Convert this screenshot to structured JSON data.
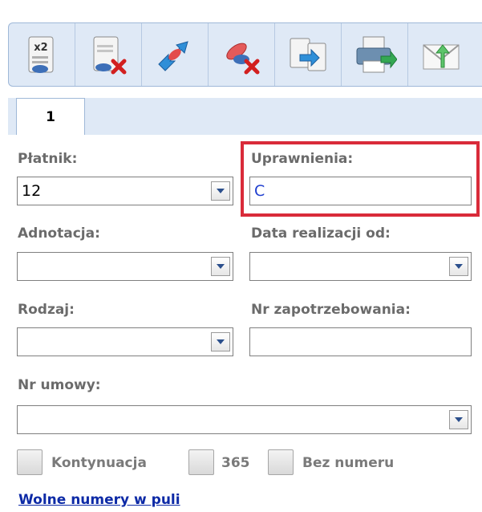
{
  "toolbar": {
    "buttons": [
      {
        "icon": "duplicate-x2-icon",
        "badge": "x2"
      },
      {
        "icon": "delete-document-icon"
      },
      {
        "icon": "swap-arrows-icon"
      },
      {
        "icon": "delete-pills-icon"
      },
      {
        "icon": "transfer-documents-icon"
      },
      {
        "icon": "print-icon"
      },
      {
        "icon": "send-mail-icon"
      }
    ]
  },
  "tabs": [
    {
      "label": "1"
    }
  ],
  "form": {
    "platnik": {
      "label": "Płatnik:",
      "value": "12"
    },
    "uprawnienia": {
      "label": "Uprawnienia:",
      "value": "C"
    },
    "adnotacja": {
      "label": "Adnotacja:",
      "value": ""
    },
    "data_realizacji": {
      "label": "Data realizacji od:",
      "value": ""
    },
    "rodzaj": {
      "label": "Rodzaj:",
      "value": ""
    },
    "nr_zapotrzebowania": {
      "label": "Nr zapotrzebowania:",
      "value": ""
    },
    "nr_umowy": {
      "label": "Nr umowy:",
      "value": ""
    }
  },
  "checkboxes": [
    {
      "label": "Kontynuacja",
      "checked": false
    },
    {
      "label": "365",
      "checked": false
    },
    {
      "label": "Bez numeru",
      "checked": false
    }
  ],
  "link": {
    "label": "Wolne numery w puli"
  },
  "colors": {
    "highlight": "#d92b3a",
    "link": "#0d2aa6",
    "value_blue": "#1f3fcf"
  }
}
